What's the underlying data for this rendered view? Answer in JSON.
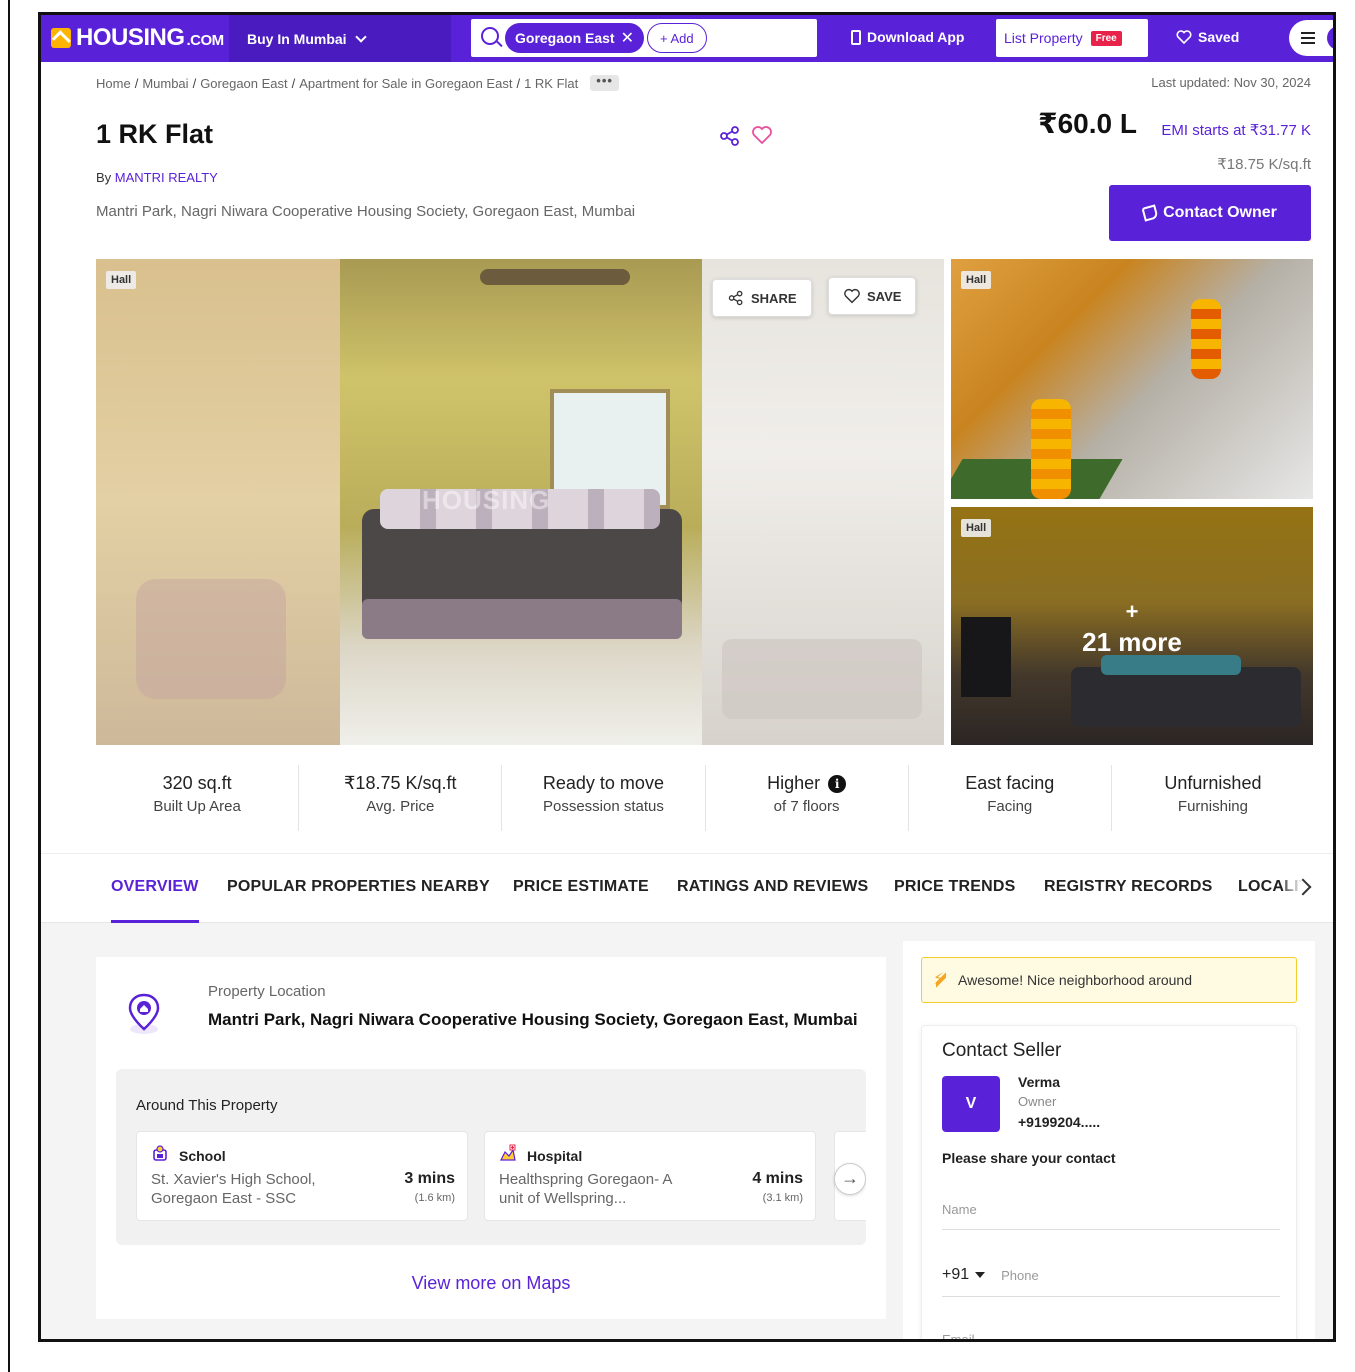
{
  "nav": {
    "logo_text": "HOUSING",
    "logo_suffix": ".COM",
    "city_button": "Buy In Mumbai",
    "search_chip": "Goregaon East",
    "add_chip": "+ Add",
    "download_app": "Download App",
    "list_property": "List Property",
    "list_property_badge": "Free",
    "saved": "Saved"
  },
  "breadcrumb": [
    "Home",
    "Mumbai",
    "Goregaon East",
    "Apartment for Sale in Goregaon East",
    "1 RK Flat"
  ],
  "breadcrumb_more": "•••",
  "last_updated": "Last updated: Nov 30, 2024",
  "listing": {
    "title": "1 RK Flat",
    "by_prefix": "By",
    "agent": "MANTRI REALTY",
    "address": "Mantri Park, Nagri Niwara Cooperative Housing Society, Goregaon East, Mumbai",
    "price": "₹60.0 L",
    "emi": "EMI starts at ₹31.77 K",
    "price_per_sqft": "₹18.75 K/sq.ft",
    "contact_owner": "Contact Owner"
  },
  "gallery": {
    "main_tag": "Hall",
    "share": "SHARE",
    "save": "SAVE",
    "watermark": "HOUSING",
    "thumb1_tag": "Hall",
    "thumb2_tag": "Hall",
    "more_plus": "+",
    "more_text": "21 more"
  },
  "stats": [
    {
      "value": "320 sq.ft",
      "label": "Built Up Area"
    },
    {
      "value": "₹18.75 K/sq.ft",
      "label": "Avg. Price"
    },
    {
      "value": "Ready to move",
      "label": "Possession status"
    },
    {
      "value": "Higher",
      "label": "of 7 floors"
    },
    {
      "value": "East facing",
      "label": "Facing"
    },
    {
      "value": "Unfurnished",
      "label": "Furnishing"
    }
  ],
  "tabs": [
    "OVERVIEW",
    "POPULAR PROPERTIES NEARBY",
    "PRICE ESTIMATE",
    "RATINGS AND REVIEWS",
    "PRICE TRENDS",
    "REGISTRY RECORDS",
    "LOCALITY"
  ],
  "location": {
    "label": "Property Location",
    "address": "Mantri Park, Nagri Niwara Cooperative Housing Society, Goregaon East, Mumbai",
    "around_title": "Around This Property",
    "places": [
      {
        "type": "School",
        "name": "St. Xavier's High School, Goregaon East - SSC",
        "time": "3 mins",
        "distance": "(1.6 km)"
      },
      {
        "type": "Hospital",
        "name": "Healthspring Goregaon- A unit of Wellspring...",
        "time": "4 mins",
        "distance": "(3.1 km)"
      }
    ],
    "next_arrow": "→",
    "maps_link": "View more on Maps"
  },
  "sidebar": {
    "banner": "Awesome! Nice neighborhood around",
    "contact_title": "Contact Seller",
    "avatar_letter": "V",
    "seller_name": "Verma",
    "seller_role": "Owner",
    "seller_phone": "+9199204.....",
    "share_prompt": "Please share your contact",
    "name_placeholder": "Name",
    "country_code": "+91",
    "phone_placeholder": "Phone",
    "email_placeholder": "Email"
  },
  "colors": {
    "brand": "#5a22d8",
    "logo_accent": "#ffb400",
    "free_badge": "#e8234a",
    "banner_border": "#f3cd2c"
  }
}
